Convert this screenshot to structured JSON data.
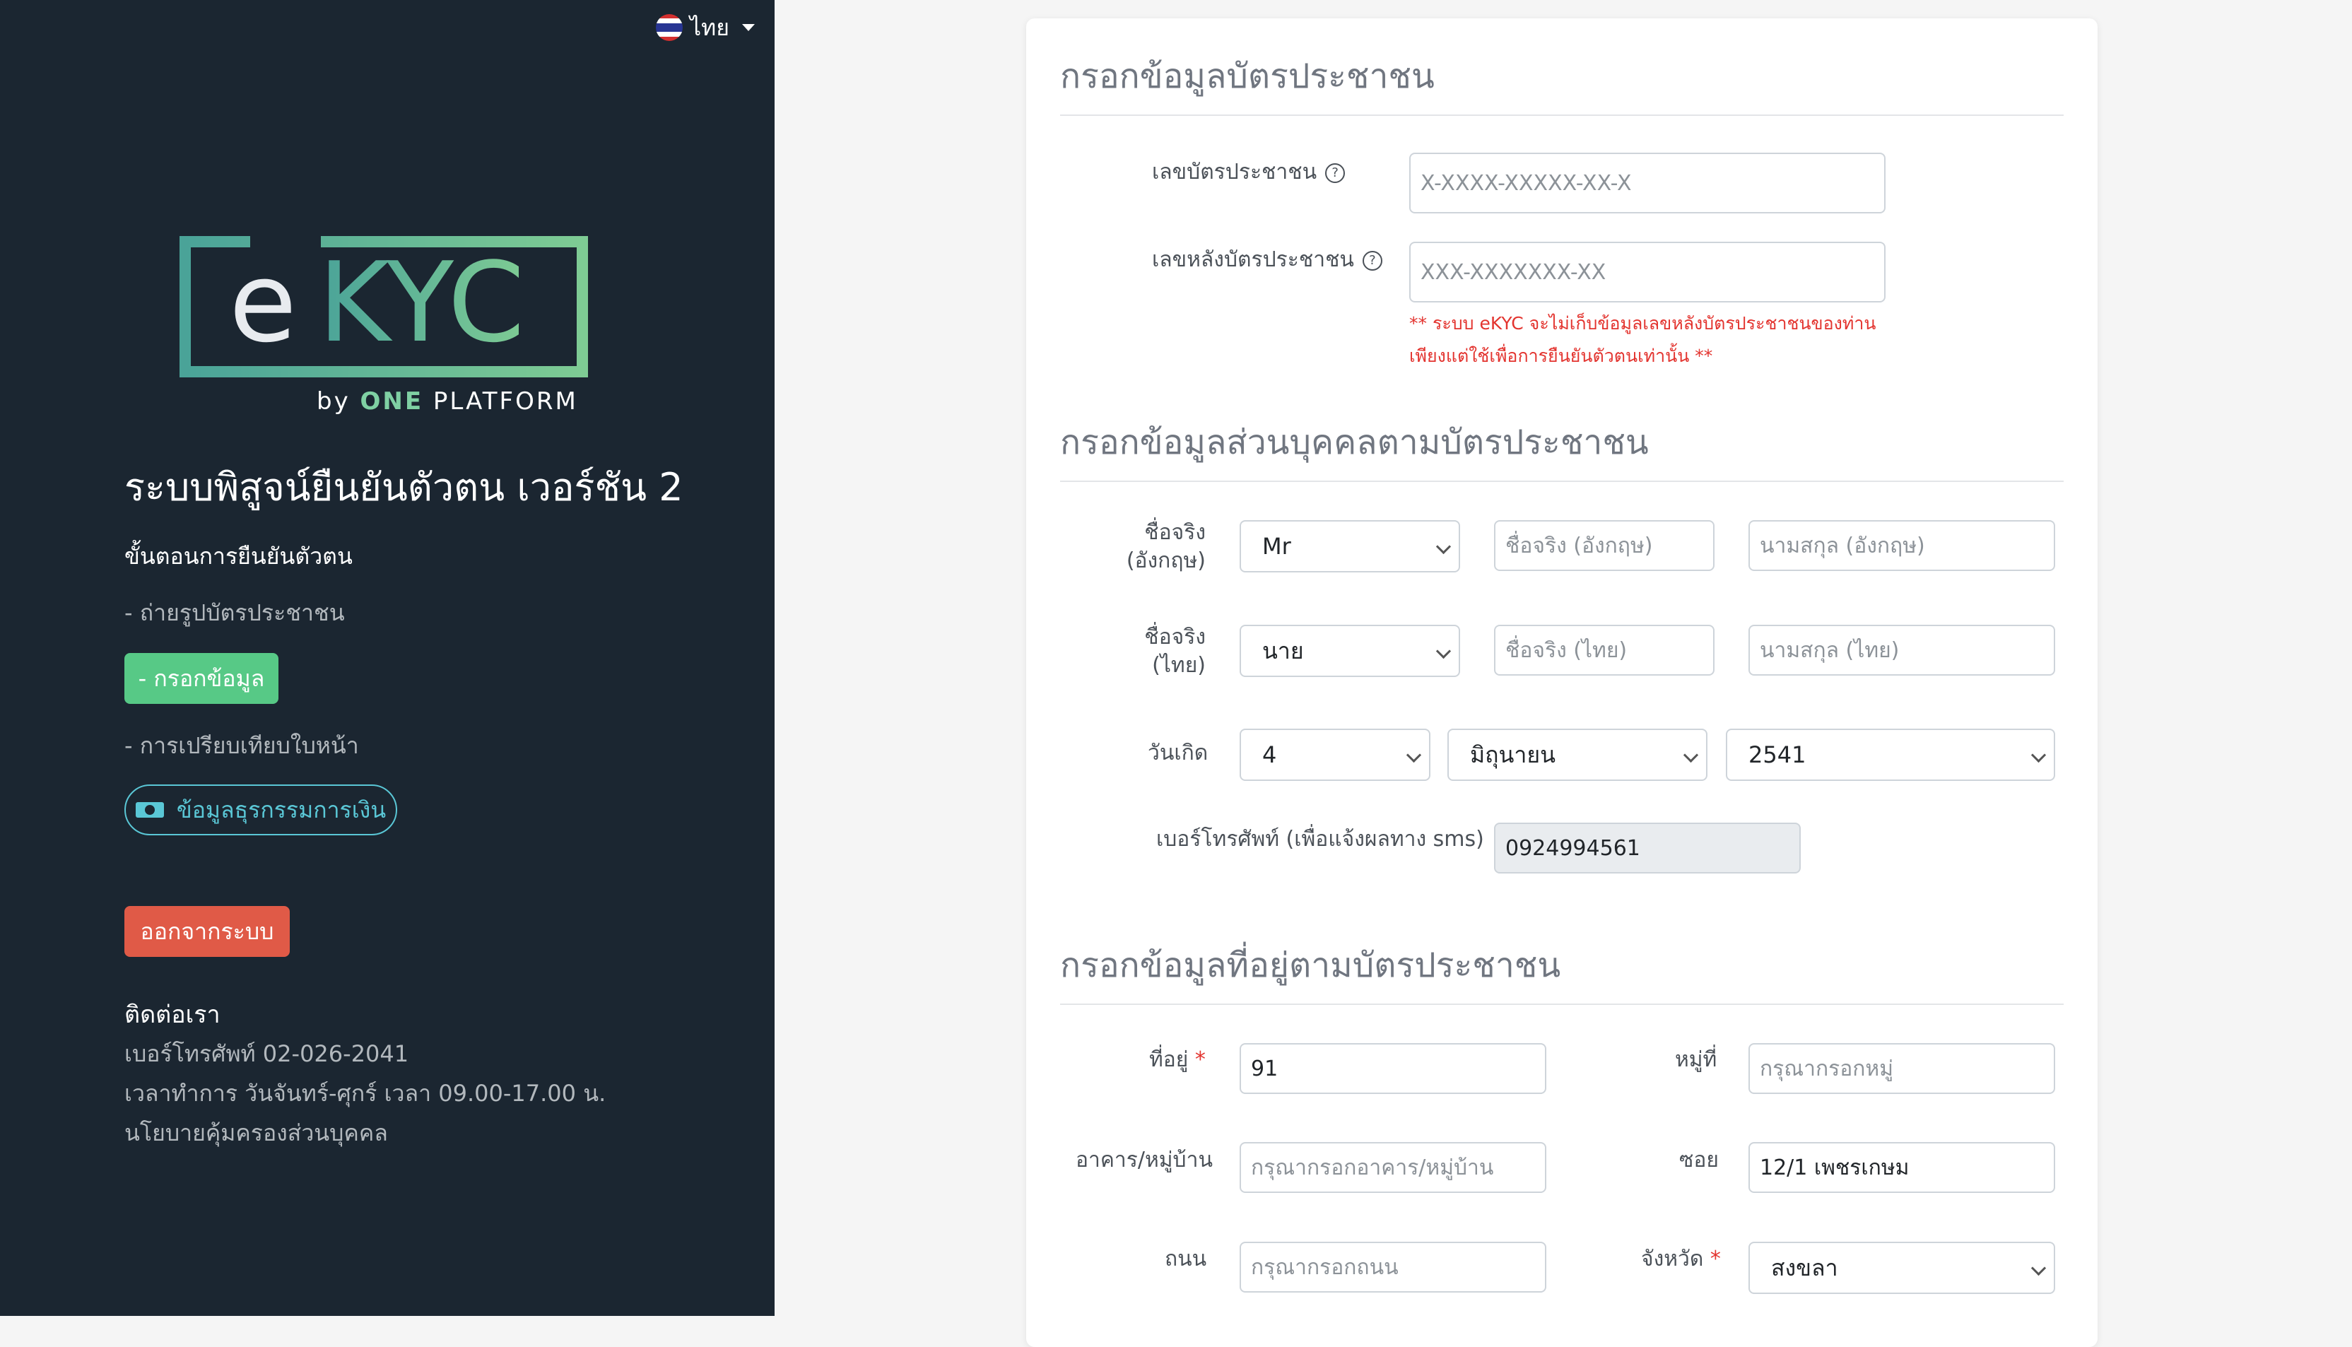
{
  "colors": {
    "sidebar_bg": "#1b2631",
    "accent_green": "#57c986",
    "danger": "#e05a47",
    "outline_cyan": "#5ac7d6",
    "required": "#e3342f"
  },
  "language": {
    "label": "ไทย",
    "flag_icon": "thai-flag-icon"
  },
  "logo": {
    "text": "eKYC",
    "by": "by",
    "brand": "ONE",
    "platform": "PLATFORM"
  },
  "sidebar": {
    "system_title": "ระบบพิสูจน์ยืนยันตัวตน เวอร์ชัน 2",
    "steps_heading": "ขั้นตอนการยืนยันตัวตน",
    "steps": [
      "- ถ่ายรูปบัตรประชาชน",
      "- กรอกข้อมูล",
      "- การเปรียบเทียบใบหน้า"
    ],
    "financial_button": "ข้อมูลธุรกรรมการเงิน",
    "logout_button": "ออกจากระบบ",
    "contact": {
      "heading": "ติดต่อเรา",
      "phone": "เบอร์โทรศัพท์ 02-026-2041",
      "hours": "เวลาทำการ วันจันทร์-ศุกร์ เวลา 09.00-17.00 น.",
      "privacy": "นโยบายคุ้มครองส่วนบุคคล"
    }
  },
  "id_section": {
    "title": "กรอกข้อมูลบัตรประชาชน",
    "id_label": "เลขบัตรประชาชน",
    "id_placeholder": "X-XXXX-XXXXX-XX-X",
    "back_label": "เลขหลังบัตรประชาชน",
    "back_placeholder": "XXX-XXXXXXX-XX",
    "warning_line1": "** ระบบ eKYC จะไม่เก็บข้อมูลเลขหลังบัตรประชาชนของท่าน",
    "warning_line2": "เพียงแต่ใช้เพื่อการยืนยันตัวตนเท่านั้น **"
  },
  "personal_section": {
    "title": "กรอกข้อมูลส่วนบุคคลตามบัตรประชาชน",
    "name_en_label_1": "ชื่อจริง",
    "name_en_label_2": "(อังกฤษ)",
    "title_en": "Mr",
    "first_en_placeholder": "ชื่อจริง (อังกฤษ)",
    "last_en_placeholder": "นามสกุล (อังกฤษ)",
    "name_th_label_1": "ชื่อจริง",
    "name_th_label_2": "(ไทย)",
    "title_th": "นาย",
    "first_th_placeholder": "ชื่อจริง (ไทย)",
    "last_th_placeholder": "นามสกุล (ไทย)",
    "birth_label": "วันเกิด",
    "birth_day": "4",
    "birth_month": "มิถุนายน",
    "birth_year": "2541",
    "phone_label": "เบอร์โทรศัพท์ (เพื่อแจ้งผลทาง sms)",
    "phone_value": "0924994561"
  },
  "address_section": {
    "title": "กรอกข้อมูลที่อยู่ตามบัตรประชาชน",
    "address_label": "ที่อยู่",
    "address_value": "91",
    "moo_label": "หมู่ที่",
    "moo_placeholder": "กรุณากรอกหมู่",
    "building_label": "อาคาร/หมู่บ้าน",
    "building_placeholder": "กรุณากรอกอาคาร/หมู่บ้าน",
    "soi_label": "ซอย",
    "soi_value": "12/1 เพชรเกษม",
    "road_label": "ถนน",
    "road_placeholder": "กรุณากรอกถนน",
    "province_label": "จังหวัด",
    "province_value": "สงขลา"
  }
}
